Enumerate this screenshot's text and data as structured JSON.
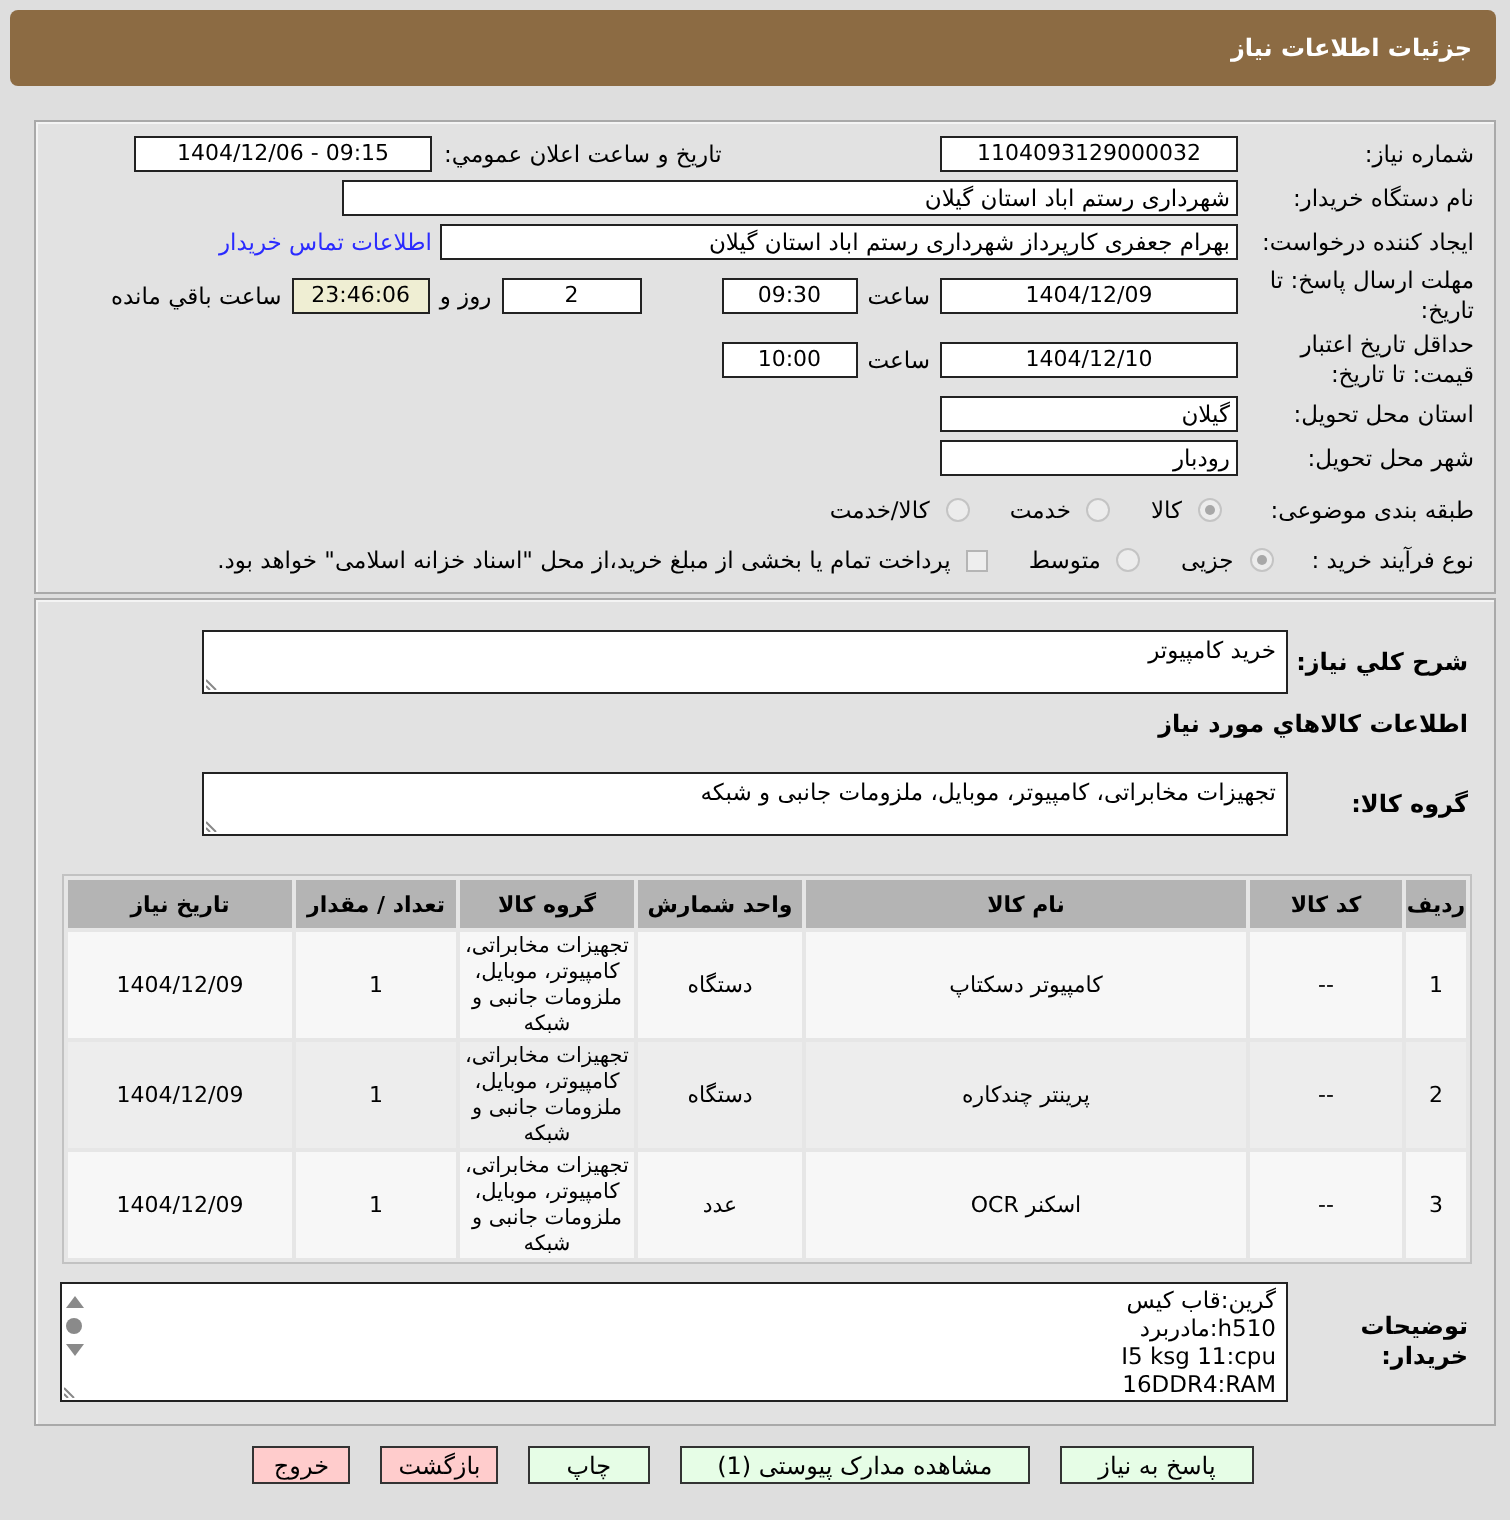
{
  "header": {
    "title": "جزئیات اطلاعات نیاز"
  },
  "form": {
    "need_number": {
      "label": "شماره نیاز:",
      "value": "1104093129000032"
    },
    "announcement": {
      "label": "تاریخ و ساعت اعلان عمومي:",
      "value": "1404/12/06 - 09:15"
    },
    "buyer_org": {
      "label": "نام دستگاه خریدار:",
      "value": "شهرداری رستم اباد استان گیلان"
    },
    "requester": {
      "label": "ایجاد کننده درخواست:",
      "value": "بهرام جعفری کارپرداز شهرداری رستم اباد استان گیلان",
      "link": "اطلاعات تماس خریدار"
    },
    "response_deadline": {
      "label": "مهلت ارسال پاسخ: تا تاریخ:",
      "date": "1404/12/09",
      "time_label": "ساعت",
      "time": "09:30",
      "days": "2",
      "days_label": "روز و",
      "remaining": "23:46:06",
      "remaining_label": "ساعت باقي مانده"
    },
    "price_validity": {
      "label": "حداقل تاریخ اعتبار قیمت: تا تاریخ:",
      "date": "1404/12/10",
      "time_label": "ساعت",
      "time": "10:00"
    },
    "delivery_province": {
      "label": "استان محل تحویل:",
      "value": "گیلان"
    },
    "delivery_city": {
      "label": "شهر محل تحویل:",
      "value": "رودبار"
    },
    "category": {
      "label": "طبقه بندی موضوعی:",
      "disabled": true,
      "options": [
        {
          "label": "کالا",
          "selected": true
        },
        {
          "label": "خدمت",
          "selected": false
        },
        {
          "label": "کالا/خدمت",
          "selected": false
        }
      ]
    },
    "process": {
      "label": "نوع فرآیند خرید :",
      "disabled": true,
      "options": [
        {
          "label": "جزیی",
          "selected": true
        },
        {
          "label": "متوسط",
          "selected": false
        }
      ],
      "treasury": {
        "label": "پرداخت تمام یا بخشی از مبلغ خرید،از محل \"اسناد خزانه اسلامی\" خواهد بود.",
        "checked": false
      }
    }
  },
  "details": {
    "description": {
      "label": "شرح کلي نیاز:",
      "value": "خرید کامپیوتر"
    },
    "items_title": "اطلاعات کالاهاي مورد نیاز",
    "group": {
      "label": "گروه کالا:",
      "value": "تجهیزات مخابراتی، کامپیوتر، موبایل، ملزومات جانبی و شبکه"
    },
    "table": {
      "columns": [
        "ردیف",
        "کد کالا",
        "نام کالا",
        "واحد شمارش",
        "گروه کالا",
        "تعداد / مقدار",
        "تاریخ نیاز"
      ],
      "rows": [
        [
          "1",
          "--",
          "کامپیوتر دسکتاپ",
          "دستگاه",
          "تجهیزات مخابراتی، کامپیوتر، موبایل، ملزومات جانبی و شبکه",
          "1",
          "1404/12/09"
        ],
        [
          "2",
          "--",
          "پرینتر چندکاره",
          "دستگاه",
          "تجهیزات مخابراتی، کامپیوتر، موبایل، ملزومات جانبی و شبکه",
          "1",
          "1404/12/09"
        ],
        [
          "3",
          "--",
          "اسکنر OCR",
          "عدد",
          "تجهیزات مخابراتی، کامپیوتر، موبایل، ملزومات جانبی و شبکه",
          "1",
          "1404/12/09"
        ]
      ]
    },
    "buyer_notes": {
      "label": "توضیحات خریدار:",
      "value": "گرین:قاب کیس\nh510:مادربرد\nI5 ksg 11:cpu\n16DDR4:RAM"
    }
  },
  "buttons": [
    {
      "label": "پاسخ به نیاز",
      "kind": "action"
    },
    {
      "label": "مشاهده مدارک پیوستی (1)",
      "kind": "action"
    },
    {
      "label": "چاپ",
      "kind": "action"
    },
    {
      "label": "بازگشت",
      "kind": "leave"
    },
    {
      "label": "خروج",
      "kind": "leave"
    }
  ]
}
